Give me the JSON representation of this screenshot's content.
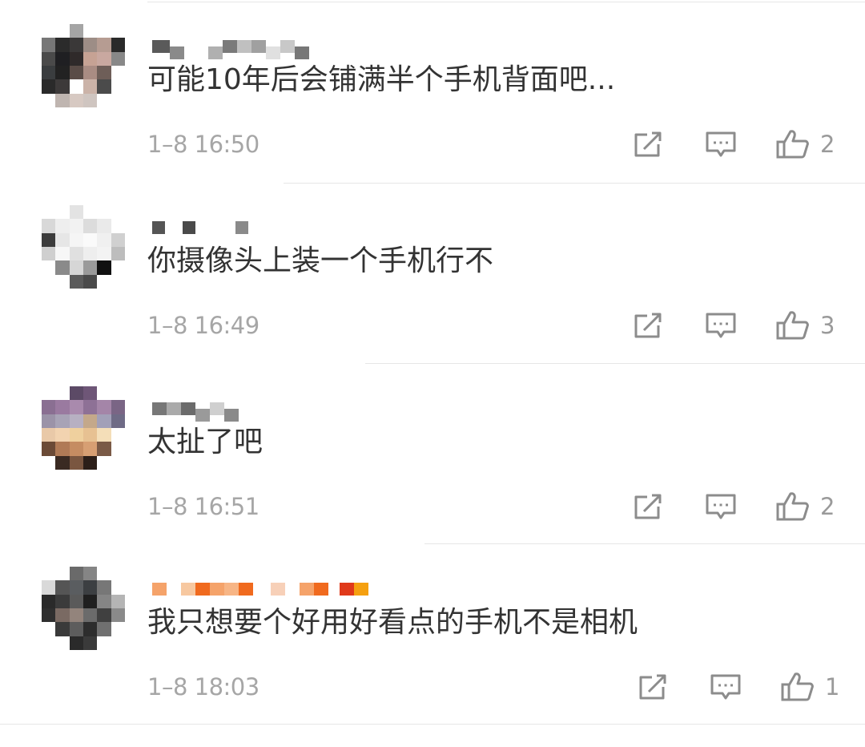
{
  "comments": [
    {
      "text": "可能10年后会铺满半个手机背面吧...",
      "time": "1–8 16:50",
      "likes": "2"
    },
    {
      "text": "你摄像头上装一个手机行不",
      "time": "1–8 16:49",
      "likes": "3"
    },
    {
      "text": "太扯了吧",
      "time": "1–8 16:51",
      "likes": "2"
    },
    {
      "text": "我只想要个好用好看点的手机不是相机",
      "time": "1–8 18:03",
      "likes": "1"
    }
  ],
  "icons": {
    "share": "share-icon",
    "reply": "comment-bubble-icon",
    "like": "thumbs-up-icon"
  },
  "colors": {
    "text": "#333333",
    "meta": "#a6a6a6",
    "icon": "#8c8c8c"
  }
}
